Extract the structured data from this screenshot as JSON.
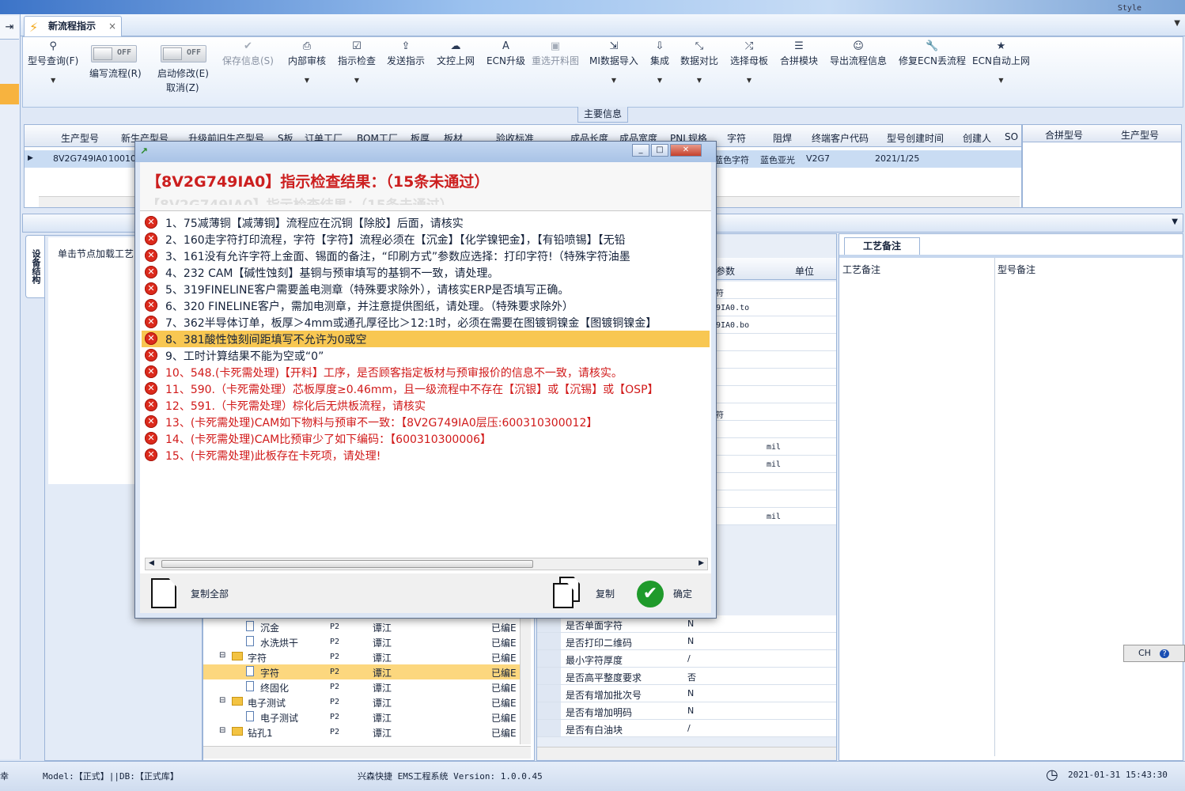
{
  "window": {
    "style_label": "Style"
  },
  "tab": {
    "title": "新流程指示",
    "close": "×"
  },
  "ribbon": {
    "buttons": [
      {
        "label": "型号查询(F)",
        "icon": "search-icon"
      },
      {
        "label": "编写流程(R)",
        "icon": "toggle"
      },
      {
        "label": "启动修改(E)",
        "icon": "toggle"
      },
      {
        "label": "取消(Z)",
        "icon": ""
      },
      {
        "label": "保存信息(S)",
        "icon": "check-icon",
        "disabled": true
      },
      {
        "label": "内部审核",
        "icon": "printer-icon"
      },
      {
        "label": "指示检查",
        "icon": "checklist-icon"
      },
      {
        "label": "发送指示",
        "icon": "upload-icon"
      },
      {
        "label": "文控上网",
        "icon": "cloud-upload-icon"
      },
      {
        "label": "ECN升级",
        "icon": "font-a-icon"
      },
      {
        "label": "重选开料图",
        "icon": "image-icon",
        "disabled": true
      },
      {
        "label": "MI数据导入",
        "icon": "import-icon"
      },
      {
        "label": "集成",
        "icon": "download-icon"
      },
      {
        "label": "数据对比",
        "icon": "compare-icon"
      },
      {
        "label": "选择母板",
        "icon": "shuffle-icon"
      },
      {
        "label": "合拼模块",
        "icon": "list-icon"
      },
      {
        "label": "导出流程信息",
        "icon": "smile-icon"
      },
      {
        "label": "修复ECN丢流程",
        "icon": "wrench-icon"
      },
      {
        "label": "ECN自动上网",
        "icon": "star-icon"
      }
    ],
    "toggle_text": "OFF",
    "main_info": "主要信息"
  },
  "grid": {
    "headers": [
      "生产型号",
      "新生产型号",
      "升级前旧生产型号",
      "S板",
      "订单工厂",
      "BOM工厂",
      "板厚",
      "板材",
      "验收标准",
      "成品长度",
      "成品宽度",
      "PNL规格",
      "字符",
      "阻焊",
      "终端客户代码",
      "型号创建时间",
      "创建人",
      "SO"
    ],
    "row": {
      "model": "8V2G749IA0",
      "new_model": "10010",
      "char": "蓝色字符",
      "mask": "蓝色亚光",
      "cust": "V2G7",
      "created": "2021/1/25"
    }
  },
  "right_grid": {
    "headers": [
      "合拼型号",
      "生产型号"
    ]
  },
  "left_panel": {
    "vtab": "设备结构",
    "hint": "单击节点加载工艺"
  },
  "tree": {
    "rows": [
      {
        "indent": 2,
        "type": "doc",
        "name": "沉金",
        "p": "P2",
        "who": "谭江",
        "st": "已编E"
      },
      {
        "indent": 2,
        "type": "doc",
        "name": "水洗烘干",
        "p": "P2",
        "who": "谭江",
        "st": "已编E"
      },
      {
        "indent": 1,
        "type": "folder",
        "name": "字符",
        "p": "P2",
        "who": "谭江",
        "st": "已编E"
      },
      {
        "indent": 2,
        "type": "doc",
        "name": "字符",
        "p": "P2",
        "who": "谭江",
        "st": "已编E",
        "selected": true
      },
      {
        "indent": 2,
        "type": "doc",
        "name": "终固化",
        "p": "P2",
        "who": "谭江",
        "st": "已编E"
      },
      {
        "indent": 1,
        "type": "folder",
        "name": "电子测试",
        "p": "P2",
        "who": "谭江",
        "st": "已编E"
      },
      {
        "indent": 2,
        "type": "doc",
        "name": "电子测试",
        "p": "P2",
        "who": "谭江",
        "st": "已编E"
      },
      {
        "indent": 1,
        "type": "folder",
        "name": "钻孔1",
        "p": "P2",
        "who": "谭江",
        "st": "已编E"
      }
    ]
  },
  "props": {
    "headers": {
      "param": "参数",
      "unit": "单位"
    },
    "upper": [
      {
        "v": "符",
        "u": ""
      },
      {
        "v": "9IA0.to",
        "u": ""
      },
      {
        "v": "9IA0.bo",
        "u": ""
      },
      {
        "v": "",
        "u": ""
      },
      {
        "v": "",
        "u": ""
      },
      {
        "v": "",
        "u": ""
      },
      {
        "v": "",
        "u": ""
      },
      {
        "v": "符",
        "u": ""
      },
      {
        "v": "",
        "u": ""
      },
      {
        "v": "",
        "u": "mil"
      },
      {
        "v": "",
        "u": "mil"
      },
      {
        "v": "",
        "u": ""
      },
      {
        "v": "",
        "u": ""
      },
      {
        "v": "",
        "u": "mil"
      }
    ],
    "lower": [
      {
        "n": "是否单面字符",
        "v": "N"
      },
      {
        "n": "是否打印二维码",
        "v": "N"
      },
      {
        "n": "最小字符厚度",
        "v": "/"
      },
      {
        "n": "是否高平整度要求",
        "v": "否"
      },
      {
        "n": "是否有增加批次号",
        "v": "N"
      },
      {
        "n": "是否有增加明码",
        "v": "N"
      },
      {
        "n": "是否有白油块",
        "v": "/"
      }
    ]
  },
  "notes": {
    "tab": "工艺备注",
    "col1": "工艺备注",
    "col2": "型号备注"
  },
  "dialog": {
    "title": "【8V2G749IA0】指示检查结果：（15条未通过）",
    "items": [
      {
        "text": "1、75减薄铜【减薄铜】流程应在沉铜【除胶】后面，请核实",
        "style": ""
      },
      {
        "text": "2、160走字符打印流程，字符【字符】流程必须在【沉金】【化学镍钯金】，【有铅喷锡】【无铅",
        "style": ""
      },
      {
        "text": "3、161没有允许字符上金面、锡面的备注，“印刷方式”参数应选择：打印字符!（特殊字符油墨",
        "style": ""
      },
      {
        "text": "4、232 CAM【碱性蚀刻】基铜与预审填写的基铜不一致，请处理。",
        "style": ""
      },
      {
        "text": "5、319FINELINE客户需要盖电测章（特殊要求除外），请核实ERP是否填写正确。",
        "style": ""
      },
      {
        "text": "6、320 FINELINE客户，需加电测章，并注意提供图纸，请处理。（特殊要求除外）",
        "style": ""
      },
      {
        "text": "7、362半导体订单，板厚＞4mm或通孔厚径比＞12:1时，必须在需要在图镀铜镍金【图镀铜镍金】",
        "style": ""
      },
      {
        "text": "8、381酸性蚀刻间距填写不允许为0或空",
        "style": "hl"
      },
      {
        "text": "9、工时计算结果不能为空或“0”",
        "style": ""
      },
      {
        "text": "10、548.(卡死需处理)【开料】工序，是否顾客指定板材与预审报价的信息不一致，请核实。",
        "style": "red"
      },
      {
        "text": "11、590.（卡死需处理）芯板厚度≥0.46mm，且一级流程中不存在【沉银】或【沉锡】或【OSP】",
        "style": "red"
      },
      {
        "text": "12、591.（卡死需处理）棕化后无烘板流程，请核实",
        "style": "red"
      },
      {
        "text": "13、(卡死需处理)CAM如下物料与预审不一致：【8V2G749IA0层压:600310300012】",
        "style": "red"
      },
      {
        "text": "14、(卡死需处理)CAM比预审少了如下编码：【600310300006】",
        "style": "red"
      },
      {
        "text": "15、(卡死需处理)此板存在卡死项，请处理!",
        "style": "red"
      }
    ],
    "copy_all": "复制全部",
    "copy": "复制",
    "ok": "确定"
  },
  "status": {
    "model": "Model:【正式】||DB:【正式库】",
    "app": "兴森快捷 EMS工程系统 Version: 1.0.0.45",
    "time": "2021-01-31 15:43:30",
    "left_char": "幸"
  },
  "ime": {
    "label": "CH"
  }
}
